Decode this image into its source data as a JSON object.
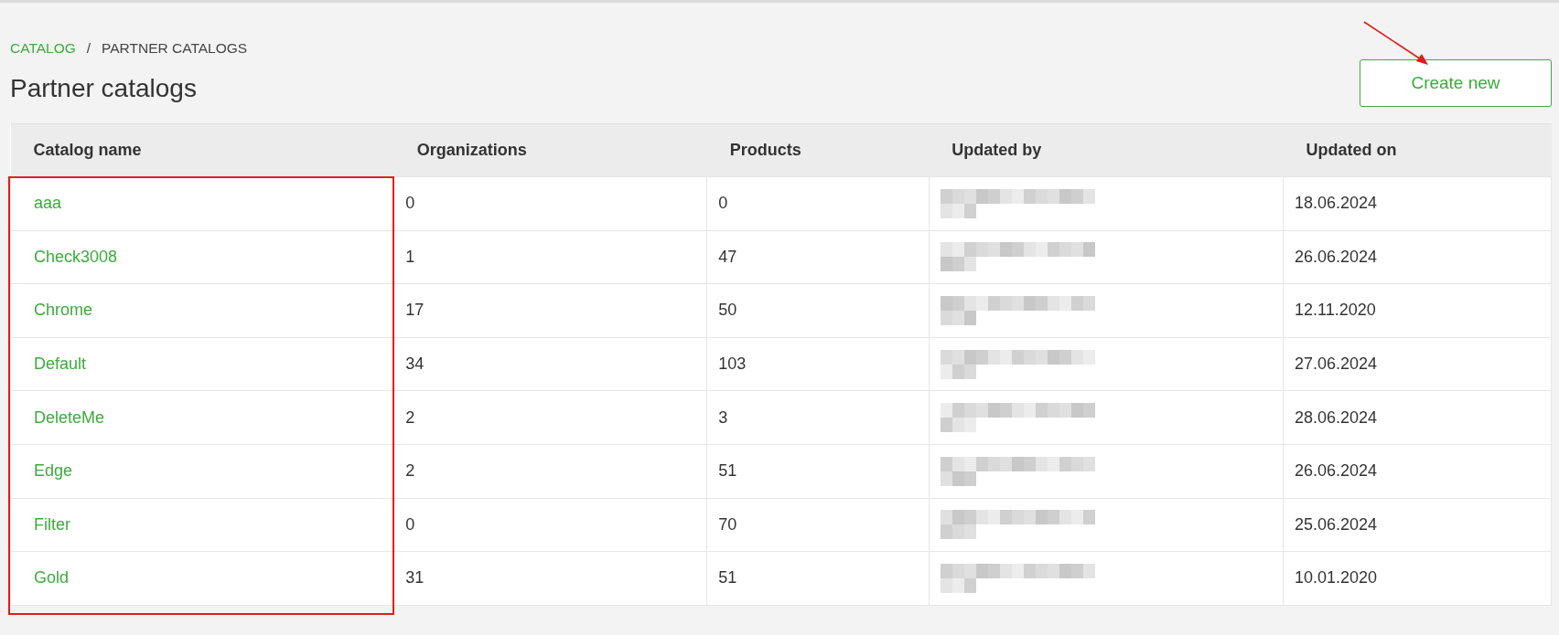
{
  "breadcrumb": [
    {
      "label": "CATALOG",
      "link": true
    },
    {
      "label": "/",
      "link": false
    },
    {
      "label": "PARTNER CATALOGS",
      "link": false
    }
  ],
  "title": "Partner catalogs",
  "create_button": "Create new",
  "table": {
    "columns": [
      "Catalog name",
      "Organizations",
      "Products",
      "Updated by",
      "Updated on"
    ],
    "rows": [
      {
        "name": "aaa",
        "organizations": "0",
        "products": "0",
        "updated_on": "18.06.2024"
      },
      {
        "name": "Check3008",
        "organizations": "1",
        "products": "47",
        "updated_on": "26.06.2024"
      },
      {
        "name": "Chrome",
        "organizations": "17",
        "products": "50",
        "updated_on": "12.11.2020"
      },
      {
        "name": "Default",
        "organizations": "34",
        "products": "103",
        "updated_on": "27.06.2024"
      },
      {
        "name": "DeleteMe",
        "organizations": "2",
        "products": "3",
        "updated_on": "28.06.2024"
      },
      {
        "name": "Edge",
        "organizations": "2",
        "products": "51",
        "updated_on": "26.06.2024"
      },
      {
        "name": "Filter",
        "organizations": "0",
        "products": "70",
        "updated_on": "25.06.2024"
      },
      {
        "name": "Gold",
        "organizations": "31",
        "products": "51",
        "updated_on": "10.01.2020"
      }
    ]
  },
  "annotations": {
    "highlight_rectangle": true,
    "arrow": true
  }
}
